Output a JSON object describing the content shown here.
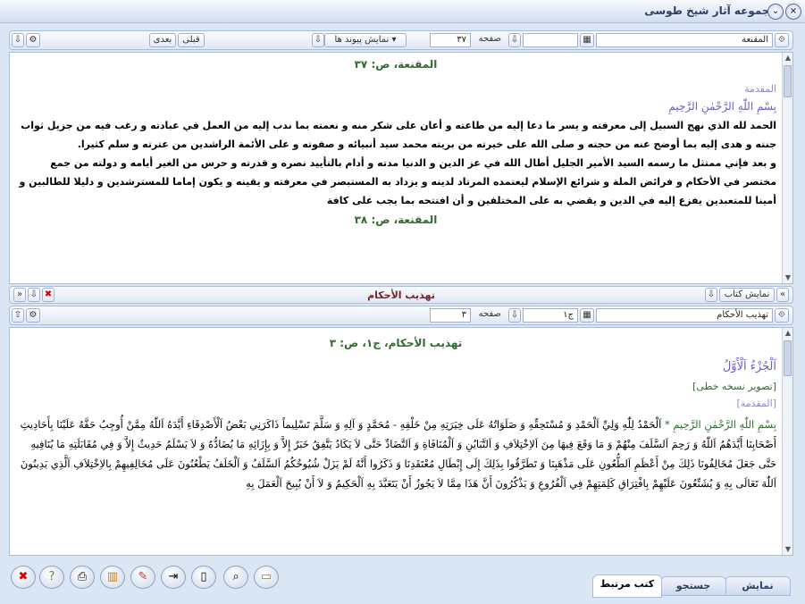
{
  "window": {
    "title": "مجموعه آثار شیخ طوسی",
    "close_symbol": "×",
    "menu_symbol": "⌄"
  },
  "top_toolbar": {
    "book_field": "المقنعة",
    "page_label": "صفحه",
    "page_value": "٣٧",
    "show_links_label": "نمایش پیوند ها",
    "prev_label": "قبلی",
    "next_label": "بعدی"
  },
  "pane1": {
    "page_header_1": "المقنعة، ص: ٣٧",
    "section_label": "المقدمة",
    "bismillah": "بِسْمِ اللّٰهِ الرَّحْمٰنِ الرَّحِيمِ",
    "para_1": "الحمد لله الذي نهج السبيل إلى معرفته و يسر ما دعا إليه من طاعته و أعان على شكر منه و نعمته بما ندب إليه من العمل في عبادته و رغب فيه من جزيل ثواب جنته و هدى إليه بما أوضح عنه من حجته و صلى الله على خيرته من بريته محمد سيد أنبيائه و صفوته و على الأئمة الراشدين من عترته و سلم كثيرا.",
    "para_2": "و بعد فإني ممتثل ما رسمه السيد الأمير الجليل أطال الله في عز الدين و الدنيا مدته و أدام بالتأييد نصره و قدرته و حرس من الغير أيامه و دولته من جمع مختصر في الأحكام و فرائض الملة و شرائع الإسلام ليعتمده المرتاد لدينه و يزداد به المستبصر في معرفته و يقينه و يكون إماما للمسترشدين و دليلا للطالبين و أمينا للمتعبدين يفزع إليه في الدين و يقضي به على المختلفين و أن افتتحه بما يجب على كافة",
    "page_header_2": "المقنعة، ص: ٣٨"
  },
  "middle_bar": {
    "title": "تهذیب الأحکام",
    "show_book_label": "نمایش کتاب"
  },
  "lower_toolbar": {
    "book_field": "تهذیب الأحکام",
    "volume_value": "ج١",
    "page_label": "صفحه",
    "page_value": "٣"
  },
  "pane2": {
    "page_header": "تهذيب الأحكام، ج١، ص: ٣",
    "juz": "اَلْجُزْءُ اَلْأَوَّلُ",
    "manuscript_label": "[تصوير نسخه خطى]",
    "section_label": "[المقدمة]",
    "bismillah": "بِسْمِ اللّٰهِ الرَّحْمٰنِ الرَّحِيمِ",
    "hadith_text": "اَلْحَمْدُ لِلّٰهِ وَلِيِّ اَلْحَمْدِ وَ مُسْتَحِقِّهِ وَ صَلَوَاتُهُ عَلَى خِيَرَتِهِ مِنْ خَلْقِهِ - مُحَمَّدٍ وَ آلِهِ وَ سَلَّمَ تَسْلِيماً ذَاكَرَنِي بَعْضُ اَلْأَصْدِقَاءِ أَيَّدَهُ اَللّٰهُ مِمَّنْ أُوجِبُ حَقَّهُ عَلَيْنَا بِأَحَادِيثِ أَصْحَابِنَا أَيَّدَهُمُ اَللّٰهُ وَ رَحِمَ اَلسَّلَفَ مِنْهُمْ وَ مَا وَقَعَ فِيهَا مِنَ اَلاِخْتِلاَفِ وَ اَلتَّبَايُنِ وَ اَلْمُنَافَاةِ وَ اَلتَّضَادِّ حَتَّى لاَ يَكَادُ يَتَّفِقُ خَبَرٌ إِلاَّ وَ بِإِزَائِهِ مَا يُضَادُّهُ وَ لاَ يَسْلَمُ حَدِيثٌ إِلاَّ وَ فِي مُقَابَلَتِهِ مَا يُنَافِيهِ حَتَّى جَعَلَ مُخَالِفُونَا ذَلِكَ مِنْ أَعْظَمِ اَلطُّعُونِ عَلَى مَذْهَبِنَا وَ تَطَرَّقُوا بِذَلِكَ إِلَى إِبْطَالِ مُعْتَقَدِنَا وَ ذَكَرُوا أَنَّهُ لَمْ يَزَلْ شُيُوخُكُمُ اَلسَّلَفُ وَ اَلْخَلَفُ يَطْعُنُونَ عَلَى مُخَالِفِيهِمْ بِالاِخْتِلاَفِ اَلَّذِي يَدِينُونَ اَللّٰهَ تَعَالَى بِهِ وَ يُشَنِّعُونَ عَلَيْهِمْ بِافْتِرَاقِ كَلِمَتِهِمْ فِي اَلْفُرُوعِ وَ يَذْكُرُونَ أَنَّ هَذَا مِمَّا لاَ يَجُوزُ أَنْ يَتَعَبَّدَ بِهِ اَلْحَكِيمُ وَ لاَ أَنْ يُبِيحَ اَلْعَمَلَ بِهِ"
  },
  "bottom_tabs": [
    {
      "label": "نمایش"
    },
    {
      "label": "جستجو"
    },
    {
      "label": "کتب مرتبط"
    }
  ],
  "bottom_icons": [
    "close-icon",
    "help-icon",
    "print-icon",
    "books-icon",
    "edit-icon",
    "export-icon",
    "blank-page-icon",
    "search-icon",
    "ruler-icon"
  ]
}
